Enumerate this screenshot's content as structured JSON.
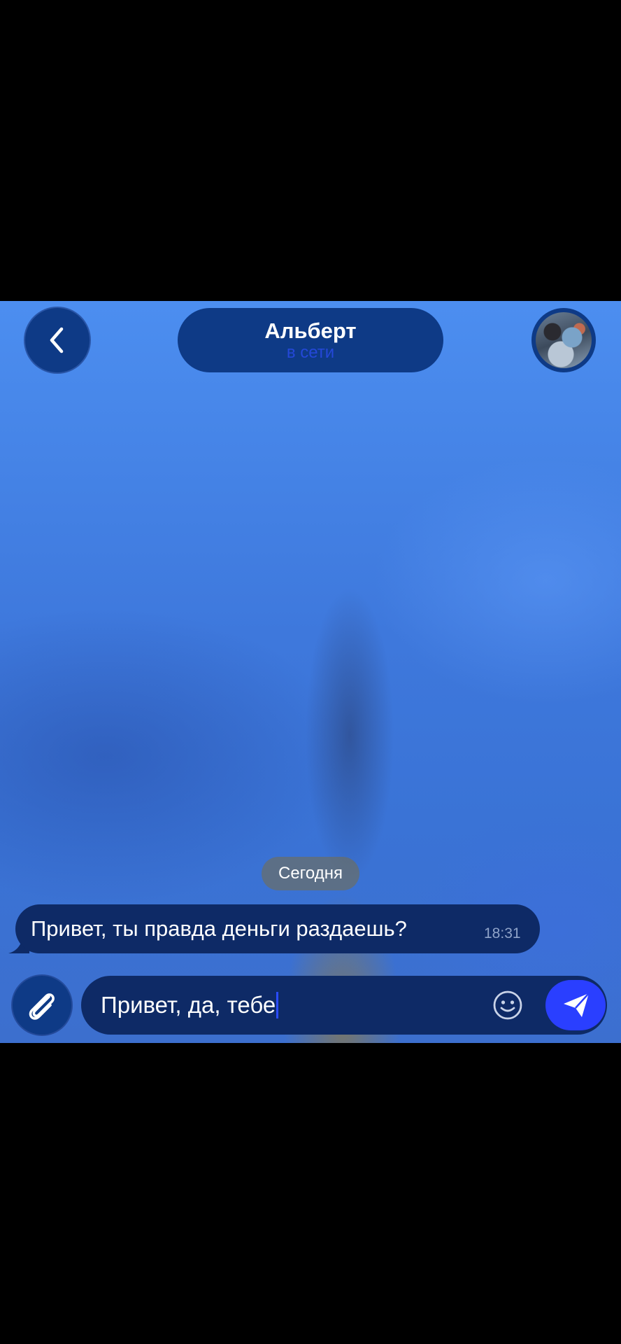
{
  "header": {
    "title": "Альберт",
    "status": "в сети"
  },
  "chat": {
    "date_separator": "Сегодня",
    "messages": [
      {
        "text": "Привет, ты правда деньги раздаешь?",
        "time": "18:31",
        "direction": "incoming"
      }
    ]
  },
  "composer": {
    "value": "Привет, да, тебе"
  },
  "icons": {
    "back": "chevron-left-icon",
    "attach": "paperclip-icon",
    "emoji": "smiley-icon",
    "send": "paper-plane-icon"
  },
  "colors": {
    "accent": "#2a3fff",
    "panel": "#0e3a86",
    "bubble": "#0e2a66",
    "background": "#3f7fe6"
  }
}
